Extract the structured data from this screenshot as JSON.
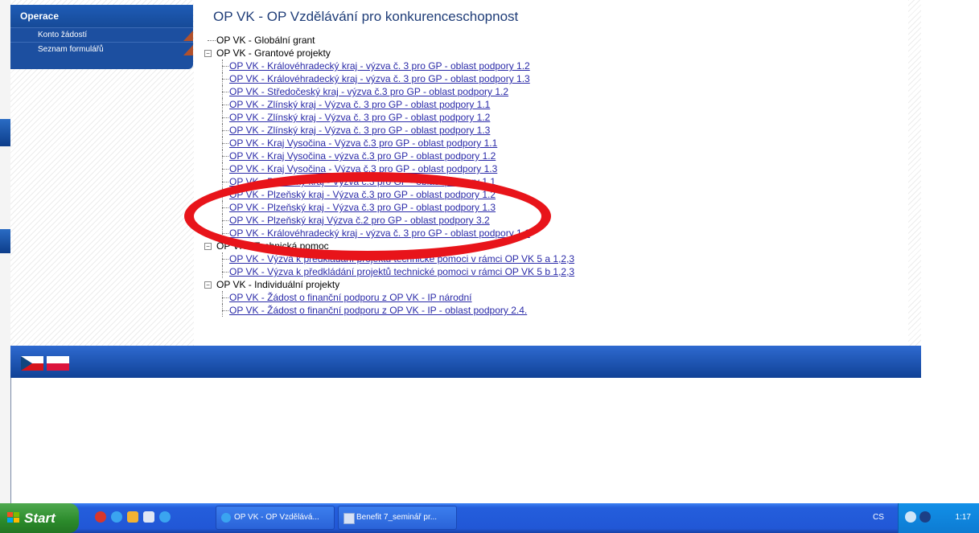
{
  "page": {
    "title": "OP VK - OP Vzdělávání pro konkurenceschopnost"
  },
  "sidebar": {
    "header": "Operace",
    "items": [
      {
        "label": "Konto žádostí"
      },
      {
        "label": "Seznam formulářů"
      }
    ]
  },
  "tree": {
    "global": "OP VK - Globální grant",
    "grant": {
      "label": "OP VK - Grantové projekty",
      "items": [
        "OP VK - Královéhradecký kraj - výzva č. 3 pro GP - oblast podpory 1.2",
        "OP VK - Královéhradecký kraj - výzva č. 3 pro GP - oblast podpory 1.3",
        "OP VK - Středočeský kraj - výzva č.3 pro GP - oblast podpory 1.2",
        "OP VK - Zlínský kraj - Výzva č. 3 pro GP - oblast podpory 1.1",
        "OP VK - Zlínský kraj - Výzva č. 3 pro GP - oblast podpory 1.2",
        "OP VK - Zlínský kraj - Výzva č. 3 pro GP - oblast podpory 1.3",
        "OP VK - Kraj Vysočina - Výzva č.3 pro GP - oblast podpory 1.1",
        "OP VK - Kraj Vysočina - výzva č.3 pro GP - oblast podpory 1.2",
        "OP VK - Kraj Vysočina - Výzva č.3 pro GP - oblast podpory 1.3",
        "OP VK - Plzeňský kraj - Výzva č.3 pro GP - oblast podpory 1.1",
        "OP VK - Plzeňský kraj - Výzva č.3 pro GP - oblast podpory 1.2",
        "OP VK - Plzeňský kraj - Výzva č.3 pro GP - oblast podpory 1.3",
        "OP VK - Plzeňský kraj Výzva č.2 pro GP - oblast podpory 3.2",
        "OP VK - Královéhradecký kraj - výzva č. 3 pro GP - oblast podpory 1.1"
      ]
    },
    "technical": {
      "label": "OP VK - Technická pomoc",
      "items": [
        "OP VK - Výzva k předkládání projektů technické pomoci v rámci OP VK 5 a 1,2,3",
        "OP VK - Výzva k předkládání projektů technické pomoci v rámci OP VK 5 b 1,2,3"
      ]
    },
    "individual": {
      "label": "OP VK - Individuální projekty",
      "items": [
        "OP VK - Žádost o finanční podporu z OP VK - IP národní",
        "OP VK - Žádost o finanční podporu z OP VK - IP - oblast podpory 2.4."
      ]
    }
  },
  "footer": {
    "flags": [
      "czech-flag",
      "polish-flag"
    ]
  },
  "taskbar": {
    "start_label": "Start",
    "tasks": [
      {
        "label": "OP VK - OP Vzdělává...",
        "icon": "ie-icon"
      },
      {
        "label": "Benefit 7_seminář pr...",
        "icon": "document-icon"
      }
    ],
    "language": "CS",
    "clock": "1:17"
  },
  "colors": {
    "sidebar_bg": "#1c4fa0",
    "link": "#2a2aa8",
    "annotation": "#e8141a",
    "taskbar": "#245edc"
  }
}
